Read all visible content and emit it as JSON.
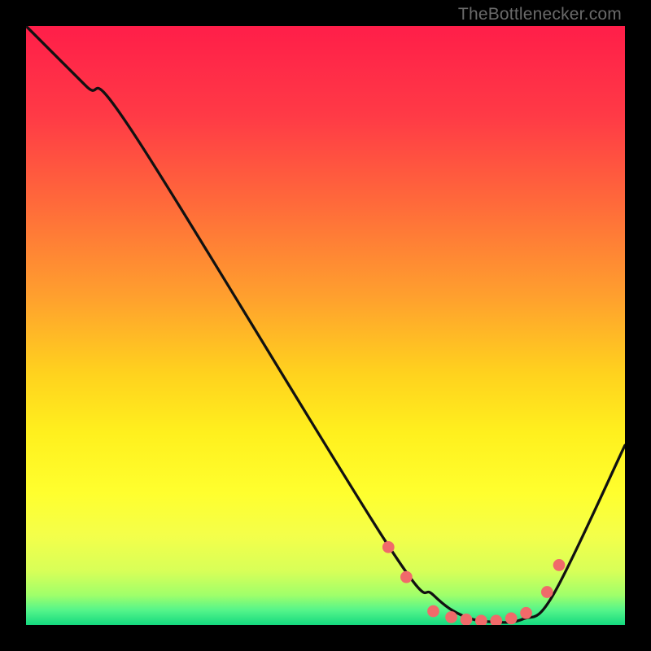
{
  "watermark": "TheBottlenecker.com",
  "colors": {
    "black": "#000000",
    "watermark": "#6a6a6a",
    "curve": "#111111",
    "dot": "#f06a6a",
    "gradient_stops": [
      {
        "offset": 0.0,
        "color": "#ff1e49"
      },
      {
        "offset": 0.15,
        "color": "#ff3a46"
      },
      {
        "offset": 0.3,
        "color": "#ff6b3a"
      },
      {
        "offset": 0.45,
        "color": "#ff9f2e"
      },
      {
        "offset": 0.58,
        "color": "#ffd21e"
      },
      {
        "offset": 0.68,
        "color": "#fff01e"
      },
      {
        "offset": 0.78,
        "color": "#ffff2e"
      },
      {
        "offset": 0.85,
        "color": "#f4ff4a"
      },
      {
        "offset": 0.91,
        "color": "#d8ff58"
      },
      {
        "offset": 0.95,
        "color": "#a0ff6a"
      },
      {
        "offset": 0.975,
        "color": "#56f58a"
      },
      {
        "offset": 1.0,
        "color": "#14d97f"
      }
    ]
  },
  "chart_data": {
    "type": "line",
    "title": "",
    "xlabel": "",
    "ylabel": "",
    "xlim": [
      0,
      100
    ],
    "ylim": [
      0,
      100
    ],
    "series": [
      {
        "name": "bottleneck-curve",
        "x": [
          0,
          10,
          18,
          60,
          68,
          73,
          78,
          83,
          88,
          100
        ],
        "y": [
          100,
          90,
          82,
          14,
          5,
          1.5,
          0.5,
          1,
          5,
          30
        ]
      }
    ],
    "dots": [
      {
        "x": 60.5,
        "y": 13
      },
      {
        "x": 63.5,
        "y": 8
      },
      {
        "x": 68,
        "y": 2.3
      },
      {
        "x": 71,
        "y": 1.3
      },
      {
        "x": 73.5,
        "y": 0.9
      },
      {
        "x": 76,
        "y": 0.7
      },
      {
        "x": 78.5,
        "y": 0.7
      },
      {
        "x": 81,
        "y": 1.1
      },
      {
        "x": 83.5,
        "y": 2.0
      },
      {
        "x": 87,
        "y": 5.5
      },
      {
        "x": 89,
        "y": 10
      }
    ]
  }
}
